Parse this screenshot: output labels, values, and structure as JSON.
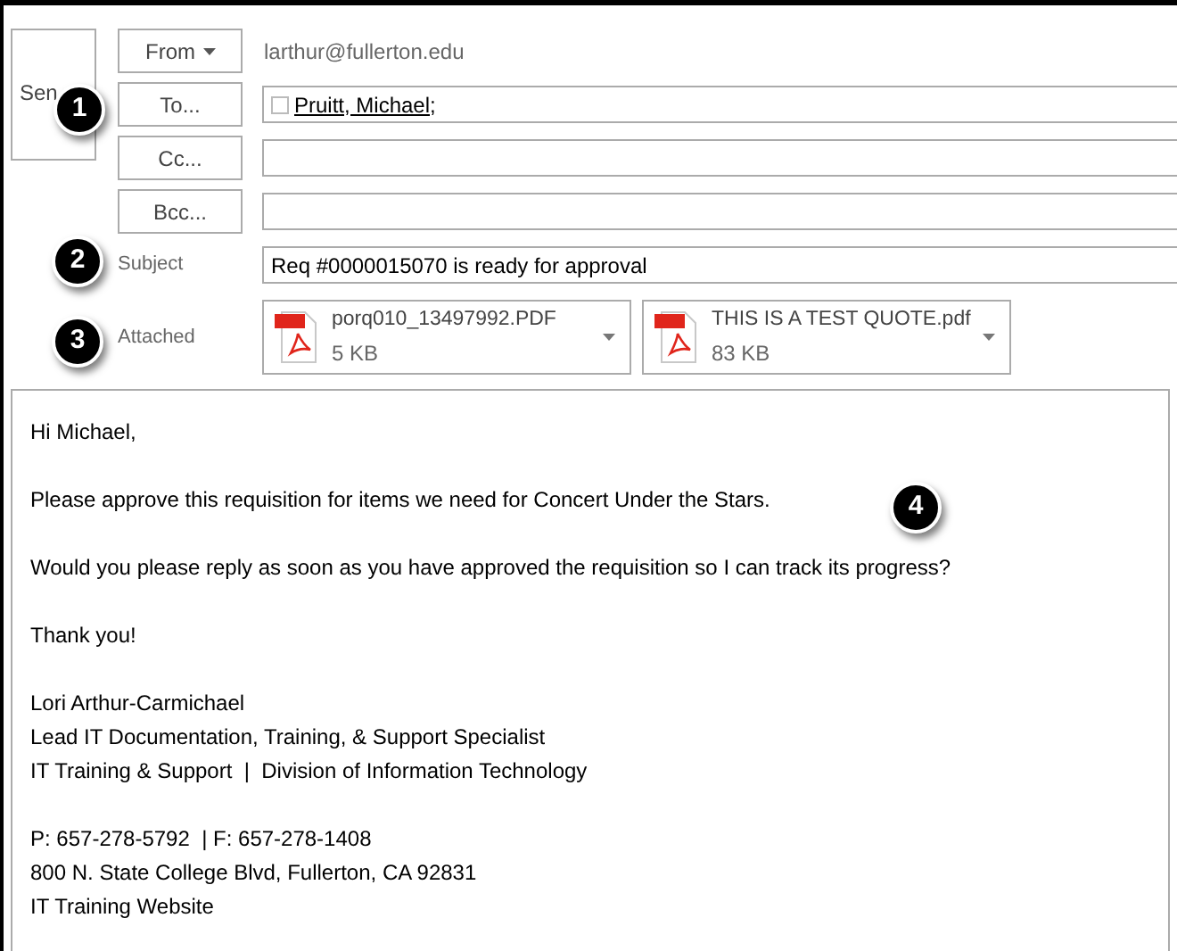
{
  "send_button": {
    "label": "Sen"
  },
  "header_buttons": [
    {
      "label": "From",
      "has_menu": true
    },
    {
      "label": "To...",
      "has_menu": false
    },
    {
      "label": "Cc...",
      "has_menu": false
    },
    {
      "label": "Bcc...",
      "has_menu": false
    }
  ],
  "from_address": "larthur@fullerton.edu",
  "to_recipients": [
    {
      "name": "Pruitt, Michael;",
      "checked": false
    }
  ],
  "subject": {
    "label": "Subject",
    "value": "Req #0000015070 is ready for approval"
  },
  "attached": {
    "label": "Attached",
    "files": [
      {
        "name": "porq010_13497992.PDF",
        "size": "5 KB"
      },
      {
        "name": "THIS IS A TEST QUOTE.pdf",
        "size": "83 KB"
      }
    ]
  },
  "body": [
    [
      "Hi Michael,"
    ],
    [
      "Please approve this requisition for items we need for Concert Under the Stars."
    ],
    [
      "Would you please reply as soon as you have approved the requisition so I can track its progress?"
    ],
    [
      "Thank you!"
    ],
    [
      "Lori Arthur-Carmichael",
      "Lead IT Documentation, Training, & Support Specialist",
      "IT Training & Support  |  Division of Information Technology"
    ],
    [
      "P: 657-278-5792  | F: 657-278-1408",
      "800 N. State College Blvd, Fullerton, CA 92831",
      "IT Training Website"
    ]
  ],
  "badges": [
    {
      "label": "1"
    },
    {
      "label": "2"
    },
    {
      "label": "3"
    },
    {
      "label": "4"
    }
  ]
}
